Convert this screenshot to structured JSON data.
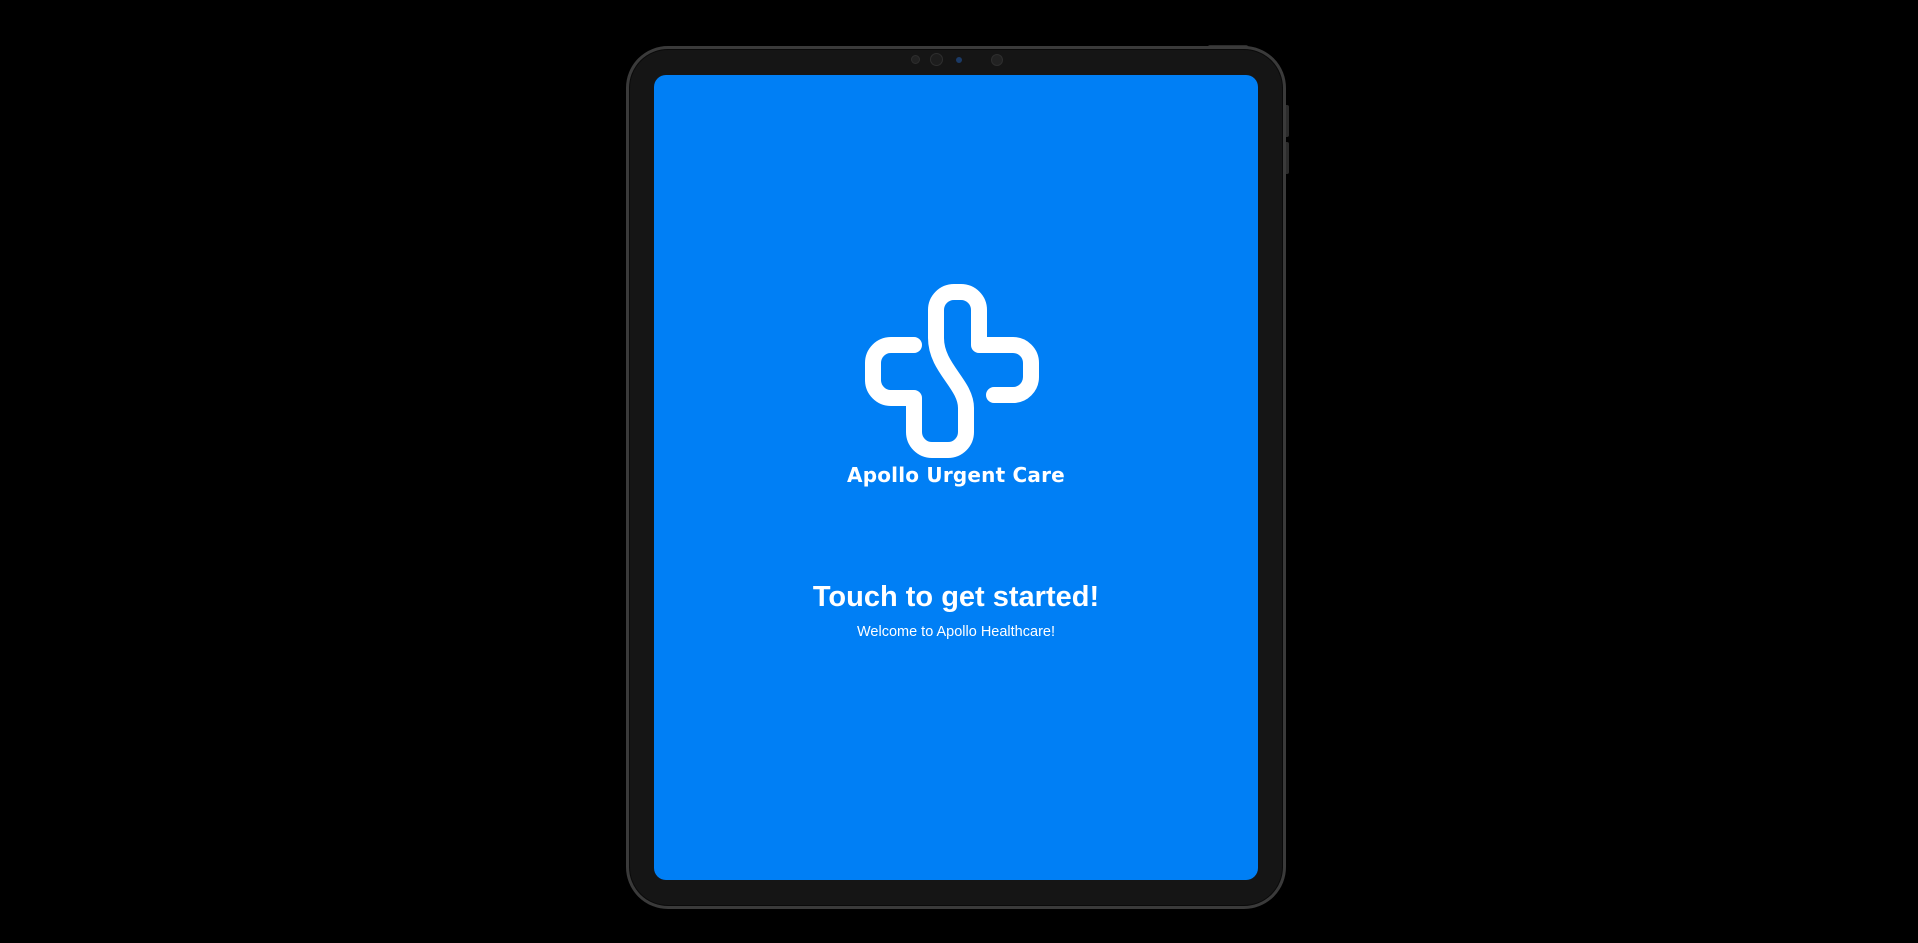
{
  "app": {
    "brand_name": "Apollo Urgent Care",
    "logo_icon": "medical-cross-icon"
  },
  "welcome": {
    "title": "Touch to get started!",
    "subtitle": "Welcome to Apollo Healthcare!"
  },
  "colors": {
    "screen_background": "#007ff5",
    "text": "#ffffff",
    "page_background": "#000000",
    "device_frame": "#151515"
  }
}
